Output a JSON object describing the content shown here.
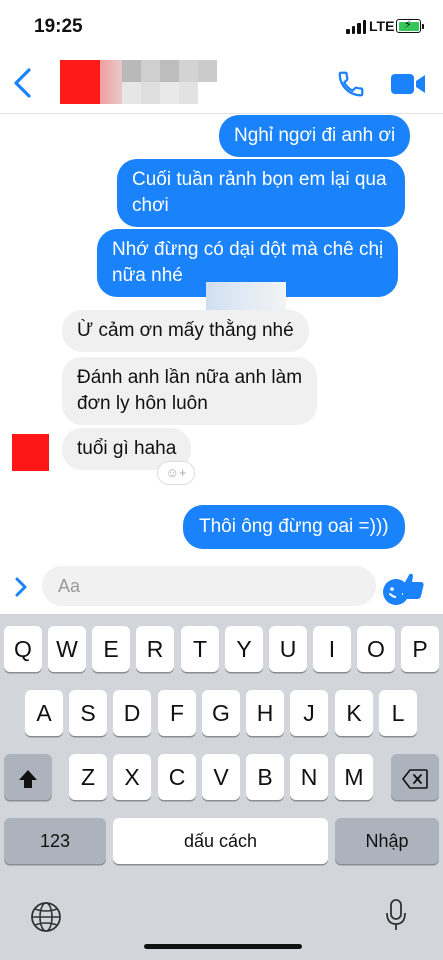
{
  "status_bar": {
    "time": "19:25",
    "network": "LTE"
  },
  "header": {
    "back_icon": "chevron-left-icon",
    "call_icon": "phone-icon",
    "video_icon": "video-camera-icon"
  },
  "messages": [
    {
      "side": "out",
      "text": "Nghỉ ngơi đi anh ơi"
    },
    {
      "side": "out",
      "line1": "Cuối tuần rảnh bọn em lại qua",
      "line2": "chơi"
    },
    {
      "side": "out",
      "line1": "Nhớ đừng có dại dột mà chê chị",
      "line2": "nữa nhé"
    },
    {
      "side": "in",
      "text": "Ừ cảm ơn mấy thằng nhé"
    },
    {
      "side": "in",
      "line1": "Đánh anh lần nữa anh làm",
      "line2": "đơn ly hôn luôn"
    },
    {
      "side": "in",
      "text": "tuổi gì haha"
    },
    {
      "side": "out",
      "text": "Thôi ông đừng oai =)))"
    }
  ],
  "composer": {
    "placeholder": "Aa",
    "emoji_icon": "smiley-icon",
    "like_icon": "thumbs-up-icon"
  },
  "keyboard": {
    "row1": [
      "Q",
      "W",
      "E",
      "R",
      "T",
      "Y",
      "U",
      "I",
      "O",
      "P"
    ],
    "row2": [
      "A",
      "S",
      "D",
      "F",
      "G",
      "H",
      "J",
      "K",
      "L"
    ],
    "row3": [
      "Z",
      "X",
      "C",
      "V",
      "B",
      "N",
      "M"
    ],
    "numbers_key": "123",
    "space_key": "dấu cách",
    "return_key": "Nhập"
  },
  "colors": {
    "accent": "#1a82fb",
    "incoming_bubble": "#f0f0f0",
    "keyboard_bg": "#d2d5da"
  }
}
